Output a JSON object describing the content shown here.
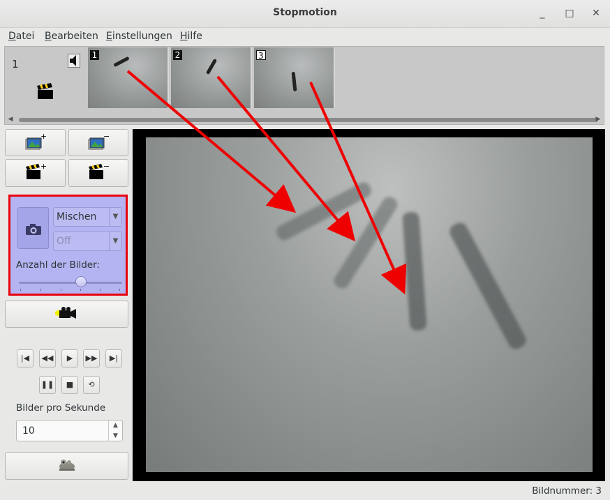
{
  "window": {
    "title": "Stopmotion"
  },
  "menu": {
    "items": [
      {
        "label_u": "D",
        "label_rest": "atei"
      },
      {
        "label_u": "B",
        "label_rest": "earbeiten"
      },
      {
        "label_u": "E",
        "label_rest": "instellungen"
      },
      {
        "label_u": "H",
        "label_rest": "ilfe"
      }
    ]
  },
  "strip": {
    "scene_number": "1",
    "frames": [
      {
        "number": "1"
      },
      {
        "number": "2"
      },
      {
        "number": "3"
      }
    ]
  },
  "mix": {
    "mode_value": "Mischen",
    "sub_value": "Off",
    "count_label": "Anzahl der Bilder:",
    "count_level_fraction": 0.6
  },
  "playback": {
    "fps_label": "Bilder pro Sekunde",
    "fps_value": "10"
  },
  "status": {
    "text": "Bildnummer: 3"
  },
  "colors": {
    "mix_highlight": "#e8000c",
    "arrow": "#ee0000"
  }
}
